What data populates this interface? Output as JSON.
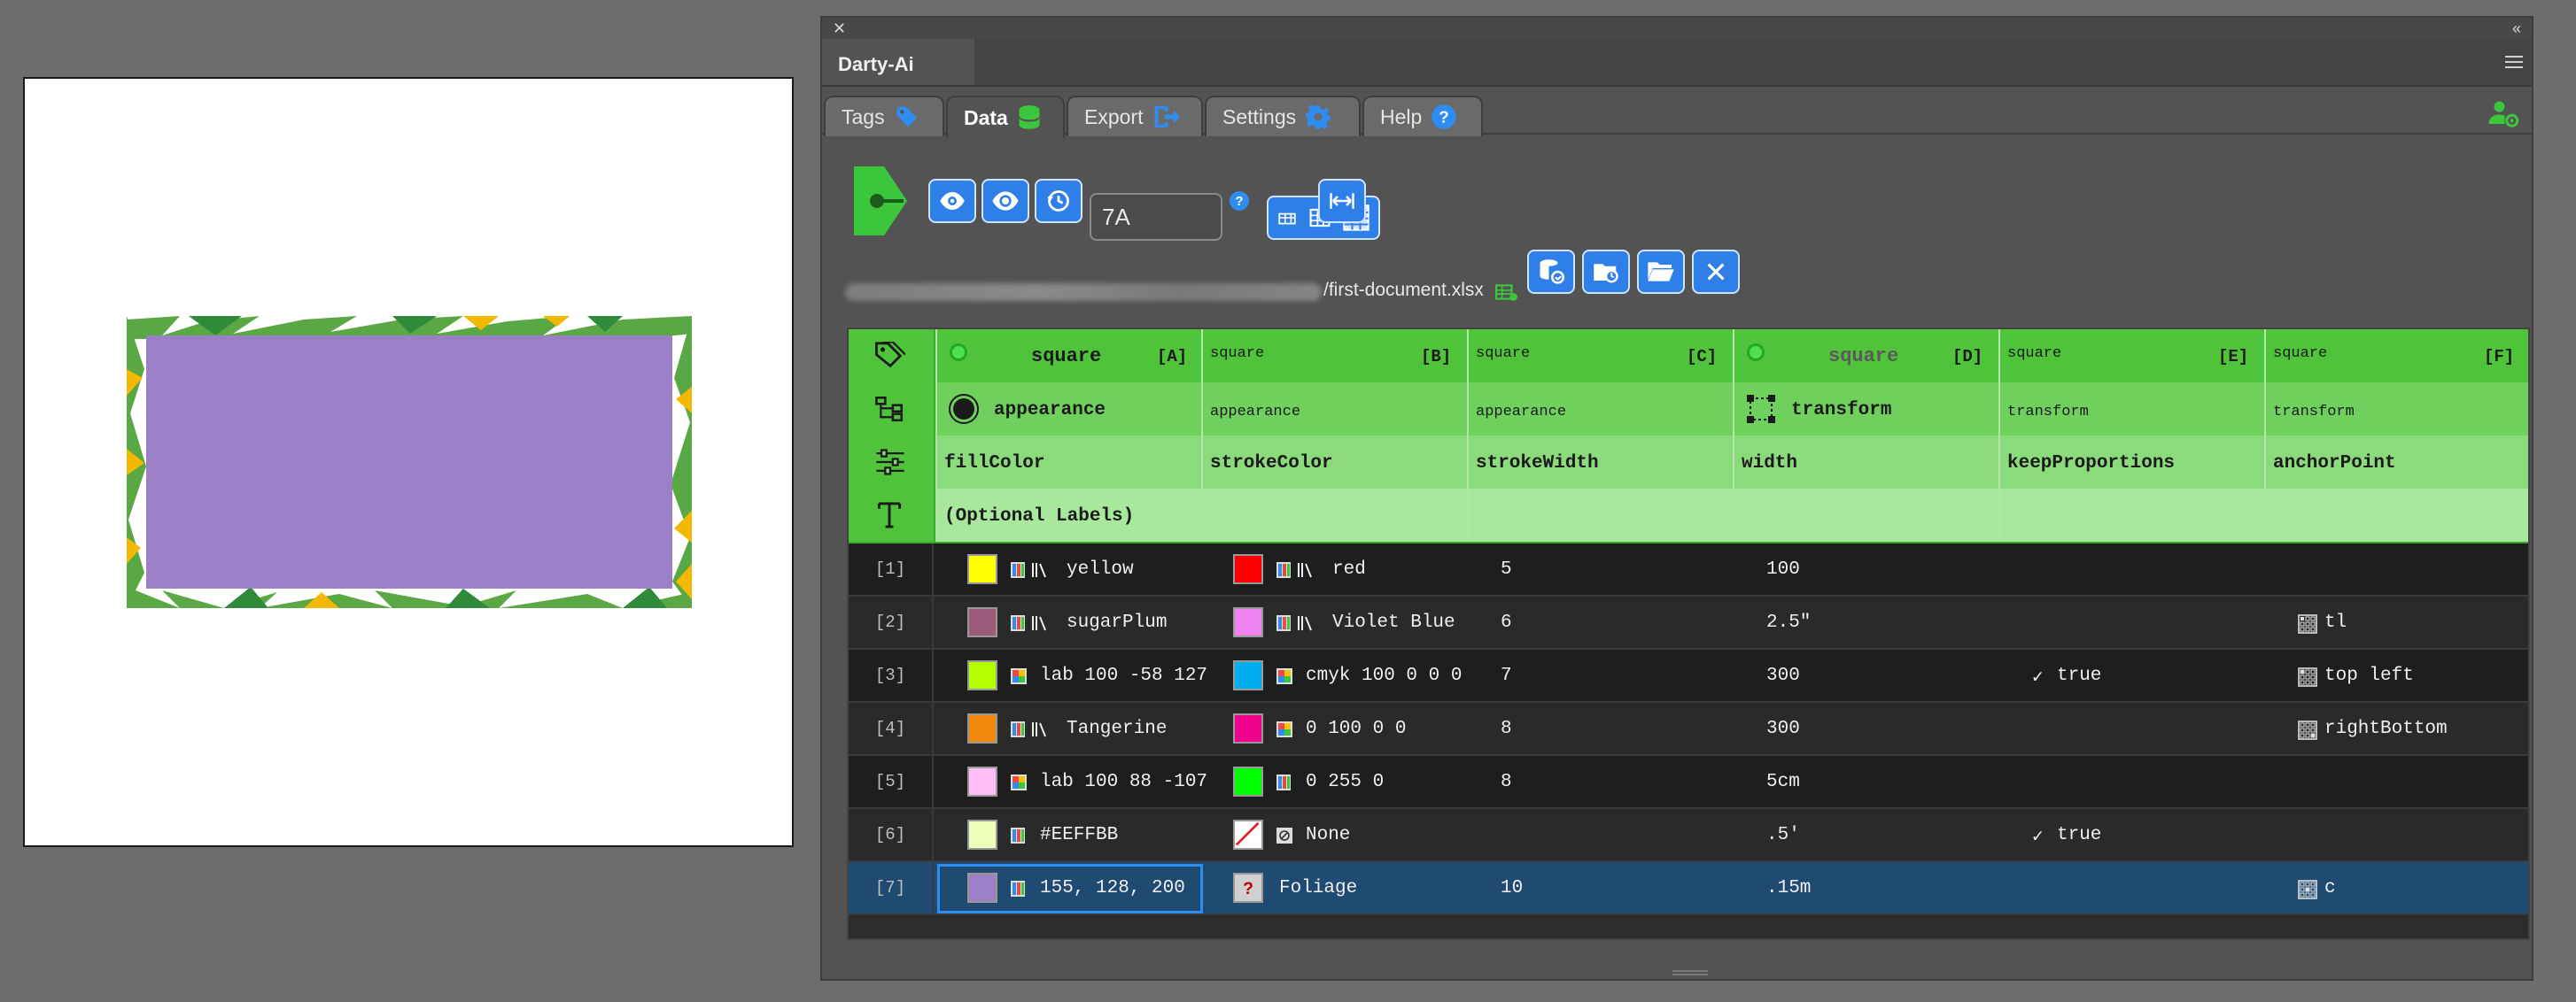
{
  "panel": {
    "title": "Darty-Ai",
    "tabs": [
      {
        "label": "Tags"
      },
      {
        "label": "Data"
      },
      {
        "label": "Export"
      },
      {
        "label": "Settings"
      },
      {
        "label": "Help"
      }
    ]
  },
  "toolbar": {
    "cell_ref": "7A",
    "help": "?"
  },
  "file": {
    "name": "/first-document.xlsx"
  },
  "grid": {
    "columns": [
      {
        "letter": "[A]",
        "tag": "square",
        "category": "appearance",
        "property": "fillColor",
        "label": "(Optional Labels)"
      },
      {
        "letter": "[B]",
        "tag": "square",
        "category": "appearance",
        "property": "strokeColor",
        "label": ""
      },
      {
        "letter": "[C]",
        "tag": "square",
        "category": "appearance",
        "property": "strokeWidth",
        "label": ""
      },
      {
        "letter": "[D]",
        "tag": "square",
        "category": "transform",
        "property": "width",
        "label": ""
      },
      {
        "letter": "[E]",
        "tag": "square",
        "category": "transform",
        "property": "keepProportions",
        "label": ""
      },
      {
        "letter": "[F]",
        "tag": "square",
        "category": "transform",
        "property": "anchorPoint",
        "label": ""
      }
    ],
    "rows": [
      {
        "num": "[1]",
        "fill": "yellow",
        "fill_color": "#ffff00",
        "stroke": "red",
        "stroke_color": "#ff0000",
        "width_stroke": "5",
        "width": "100",
        "keep": "",
        "anchor": ""
      },
      {
        "num": "[2]",
        "fill": "sugarPlum",
        "fill_color": "#9b5a77",
        "stroke": "Violet Blue",
        "stroke_color": "#ee82ee",
        "width_stroke": "6",
        "width": "2.5\"",
        "keep": "",
        "anchor": "tl"
      },
      {
        "num": "[3]",
        "fill": "lab 100 -58 127",
        "fill_color": "#b5ff00",
        "stroke": "cmyk 100 0 0 0",
        "stroke_color": "#00aeef",
        "width_stroke": "7",
        "width": "300",
        "keep": "true",
        "anchor": "top left"
      },
      {
        "num": "[4]",
        "fill": "Tangerine",
        "fill_color": "#f28a0f",
        "stroke": "0 100 0 0",
        "stroke_color": "#ec008c",
        "width_stroke": "8",
        "width": "300",
        "keep": "",
        "anchor": "rightBottom"
      },
      {
        "num": "[5]",
        "fill": "lab 100 88 -107",
        "fill_color": "#ffbdf5",
        "stroke": "0 255 0",
        "stroke_color": "#00ff00",
        "width_stroke": "8",
        "width": "5cm",
        "keep": "",
        "anchor": ""
      },
      {
        "num": "[6]",
        "fill": "#EEFFBB",
        "fill_color": "#eeffbb",
        "stroke": "None",
        "stroke_color": "#ffffff",
        "width_stroke": "",
        "width": ".5'",
        "keep": "true",
        "anchor": ""
      },
      {
        "num": "[7]",
        "fill": "155, 128, 200",
        "fill_color": "#9b80c8",
        "stroke": "Foliage",
        "stroke_color": "#d0d0d0",
        "width_stroke": "10",
        "width": ".15m",
        "keep": "",
        "anchor": "c"
      }
    ]
  },
  "colors": {
    "accent_blue": "#2f7fe8",
    "header_green": "#4fc43a",
    "selected_row": "#1f4a72",
    "artwork_fill": "#9b80c8"
  }
}
